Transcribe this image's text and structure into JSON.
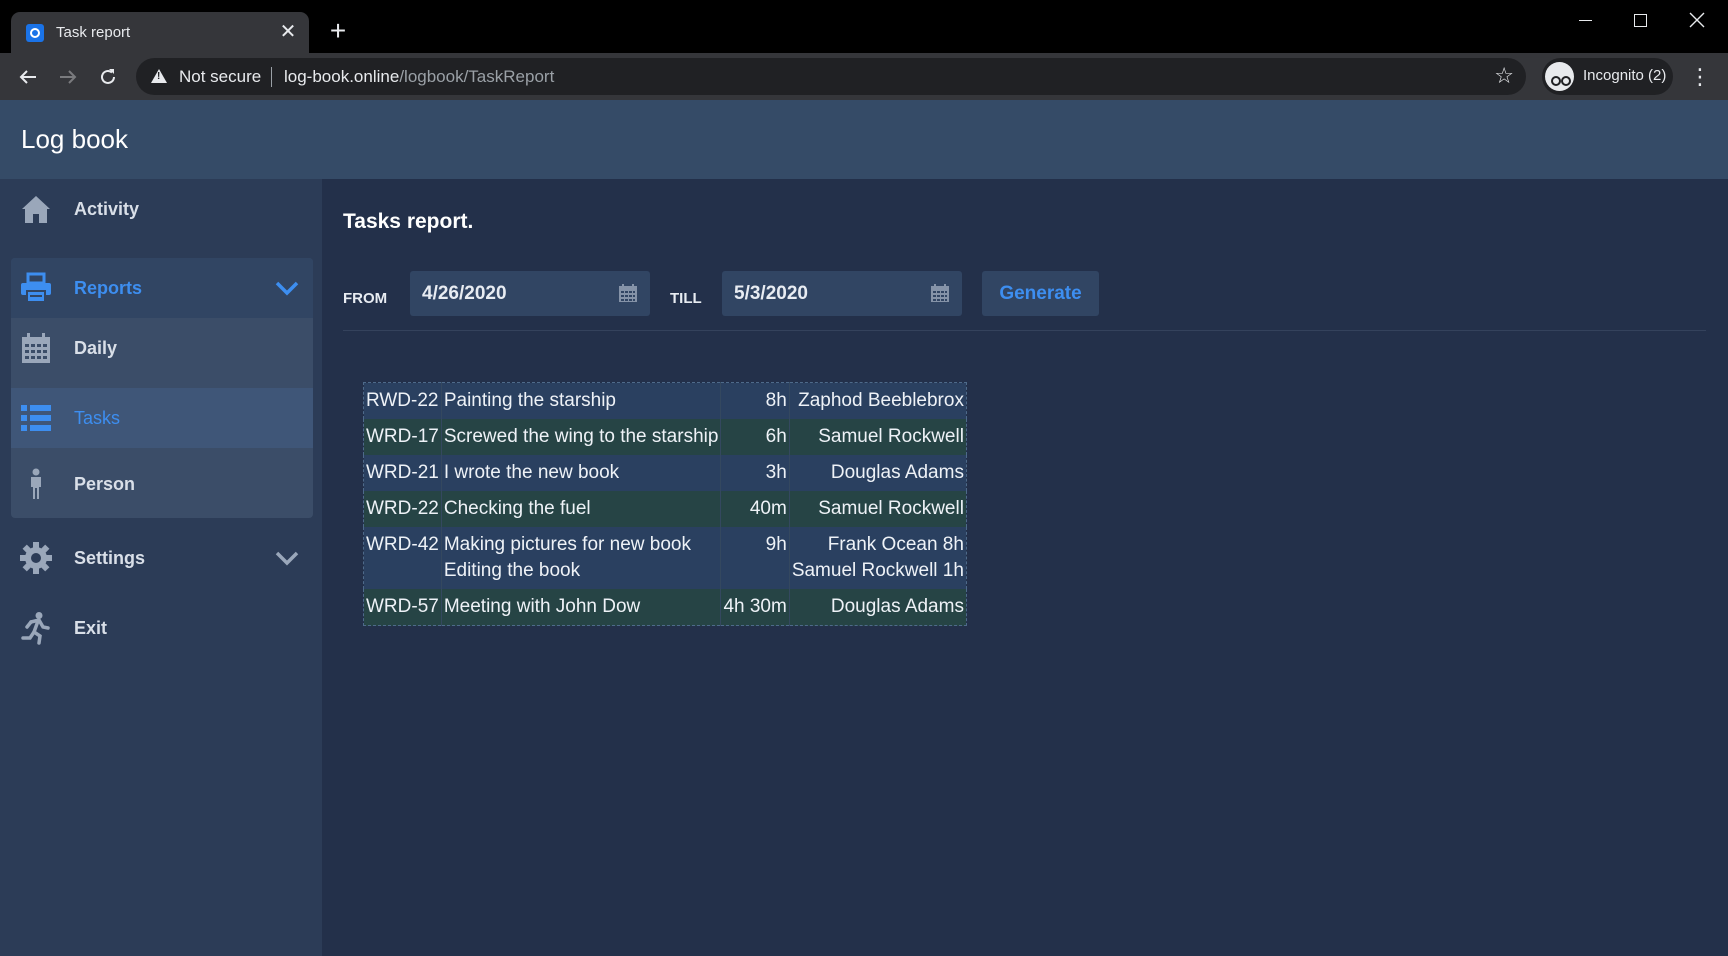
{
  "browser": {
    "tab_title": "Task report",
    "tab_close": "✕",
    "new_tab": "+",
    "security_label": "Not secure",
    "url_host": "log-book.online",
    "url_path": "/logbook/TaskReport",
    "profile_label": "Incognito (2)"
  },
  "app": {
    "title": "Log book"
  },
  "sidebar": {
    "items": [
      {
        "label": "Activity",
        "icon": "home-icon"
      },
      {
        "label": "Reports",
        "icon": "printer-icon",
        "expanded": true
      },
      {
        "label": "Daily",
        "icon": "calendar-icon"
      },
      {
        "label": "Tasks",
        "icon": "task-list-icon",
        "active": true
      },
      {
        "label": "Person",
        "icon": "person-icon"
      },
      {
        "label": "Settings",
        "icon": "gear-icon"
      },
      {
        "label": "Exit",
        "icon": "running-exit-icon"
      }
    ]
  },
  "report": {
    "title": "Tasks report.",
    "from_label": "FROM",
    "from_value": "4/26/2020",
    "till_label": "TILL",
    "till_value": "5/3/2020",
    "generate_label": "Generate",
    "rows": [
      {
        "code": "RWD-22",
        "tasks": [
          "Painting the starship"
        ],
        "time": "8h",
        "people": [
          "Zaphod Beeblebrox"
        ]
      },
      {
        "code": "WRD-17",
        "tasks": [
          "Screwed the wing to the starship"
        ],
        "time": "6h",
        "people": [
          "Samuel Rockwell"
        ]
      },
      {
        "code": "WRD-21",
        "tasks": [
          "I wrote the new book"
        ],
        "time": "3h",
        "people": [
          "Douglas Adams"
        ]
      },
      {
        "code": "WRD-22",
        "tasks": [
          "Checking the fuel"
        ],
        "time": "40m",
        "people": [
          "Samuel Rockwell"
        ]
      },
      {
        "code": "WRD-42",
        "tasks": [
          "Making pictures for new book",
          "Editing the book"
        ],
        "time": "9h",
        "people": [
          "Frank Ocean 8h",
          "Samuel Rockwell 1h"
        ]
      },
      {
        "code": "WRD-57",
        "tasks": [
          "Meeting with John Dow"
        ],
        "time": "4h 30m",
        "people": [
          "Douglas Adams"
        ]
      }
    ]
  },
  "colors": {
    "accent": "#3d8ef0",
    "header_bg": "#354b67",
    "sidebar_bg": "#2c3c57",
    "main_bg": "#23304a"
  }
}
